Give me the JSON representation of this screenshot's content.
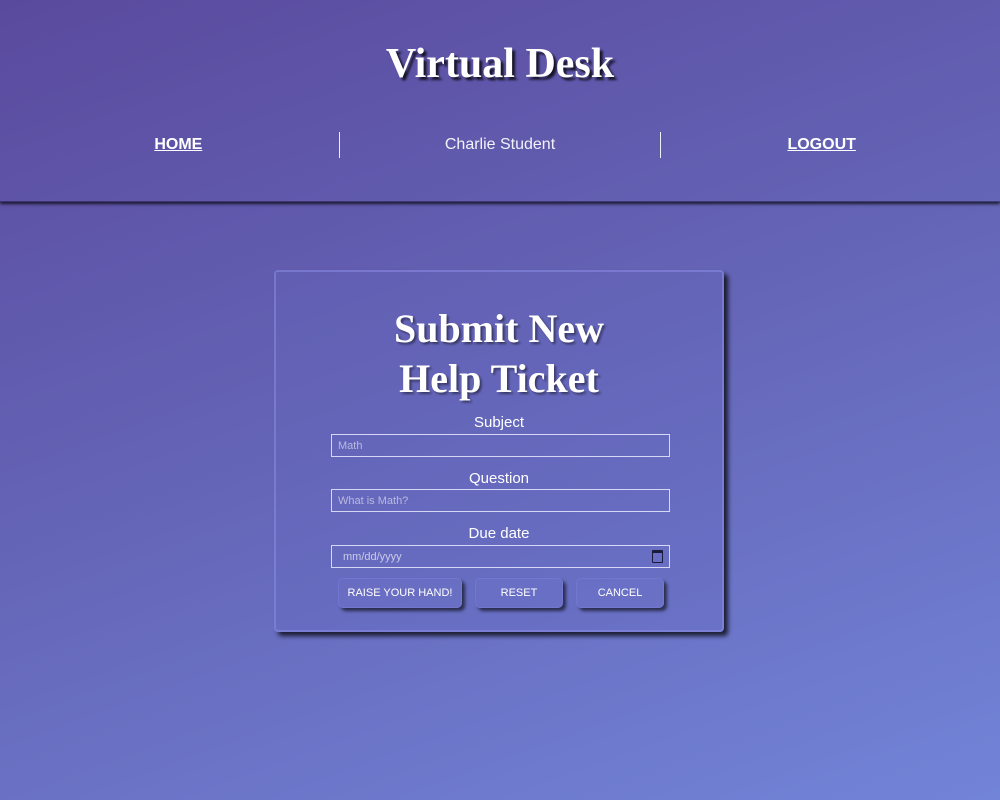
{
  "header": {
    "title": "Virtual Desk",
    "nav": {
      "home": "HOME",
      "user": "Charlie Student",
      "logout": "LOGOUT"
    }
  },
  "ticket_form": {
    "title_line1": "Submit New",
    "title_line2": "Help Ticket",
    "subject": {
      "label": "Subject",
      "placeholder": "Math"
    },
    "question": {
      "label": "Question",
      "placeholder": "What is Math?"
    },
    "due_date": {
      "label": "Due date",
      "placeholder": "mm/dd/yyyy"
    },
    "buttons": {
      "submit": "RAISE YOUR HAND!",
      "reset": "RESET",
      "cancel": "CANCEL"
    }
  },
  "icons": {
    "date_picker": "calendar-icon"
  },
  "colors": {
    "background_start": "#5a4a9e",
    "background_end": "#7284d8",
    "text": "#ffffff"
  }
}
